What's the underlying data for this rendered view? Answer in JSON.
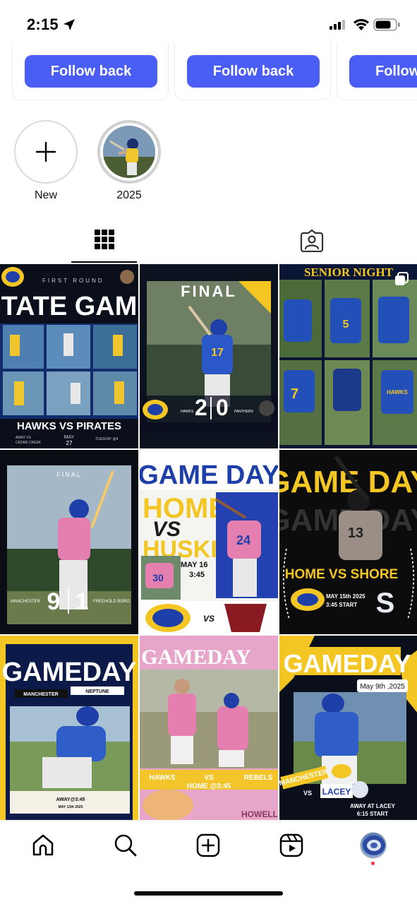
{
  "status_bar": {
    "time": "2:15"
  },
  "suggestions": [
    {
      "button_label": "Follow back"
    },
    {
      "button_label": "Follow back"
    },
    {
      "button_label": "Follow back"
    }
  ],
  "highlights": [
    {
      "label": "New",
      "icon": "plus-icon"
    },
    {
      "label": "2025",
      "icon": "photo"
    }
  ],
  "tabs": [
    {
      "name": "posts-grid",
      "icon": "grid-icon",
      "active": true
    },
    {
      "name": "tagged",
      "icon": "tagged-person-icon",
      "active": false
    }
  ],
  "posts": [
    {
      "title": "STATE GAME",
      "top": "FIRST ROUND",
      "bottom": "HAWKS VS PIRATES",
      "sub_left": "AWAY VS",
      "sub_left2": "CEDAR CREEK",
      "month": "MAY",
      "day": "27",
      "sub_right": "TUESDAY @4",
      "pinned": false
    },
    {
      "title": "FINAL",
      "left_team": "HAWKS",
      "right_team": "PANTHERS",
      "score_left": "2",
      "score_right": "0",
      "jersey": "17",
      "pinned": false
    },
    {
      "title": "SENIOR NIGHT",
      "jerseys": [
        "5",
        "7"
      ],
      "text_jersey": "HAWKS",
      "pinned": true
    },
    {
      "title": "FINAL",
      "left_team": "MANCHESTER",
      "right_team": "FREEHOLD BORO",
      "score_left": "9",
      "score_right": "1",
      "pinned": false
    },
    {
      "title": "GAME DAY",
      "line1": "HOME",
      "vs": "VS",
      "line2": "HUSKIES",
      "date": "MAY 16",
      "time": "3:45",
      "jersey_a": "30",
      "jersey_b": "24",
      "pinned": false
    },
    {
      "title": "GAME DAY",
      "line": "HOME VS SHORE",
      "date": "MAY 15th 2025",
      "start": "3:45 START",
      "jersey": "13",
      "pinned": false
    },
    {
      "title": "GAMEDAY",
      "left_team": "MANCHESTER",
      "right_team": "NEPTUNE",
      "away": "AWAY@3:45",
      "date": "MAY 13th 2025",
      "pinned": false
    },
    {
      "title": "GAMEDAY",
      "left_team": "HAWKS",
      "vs": "VS",
      "right_team": "REBELS",
      "home": "HOME @3:45",
      "footer": "HOWELL",
      "pinned": false
    },
    {
      "title": "GAMEDAY",
      "date": "May 9th ,2025",
      "left_team": "MANCHESTER",
      "vs": "VS",
      "right_team": "LACEY",
      "away": "AWAY AT LACEY",
      "start": "6:15 START",
      "pinned": false
    }
  ],
  "nav": [
    {
      "name": "home",
      "icon": "home-icon"
    },
    {
      "name": "search",
      "icon": "search-icon"
    },
    {
      "name": "create",
      "icon": "create-plus-icon"
    },
    {
      "name": "reels",
      "icon": "reels-icon"
    },
    {
      "name": "profile",
      "icon": "profile-avatar"
    }
  ],
  "colors": {
    "accent": "#4a5df5",
    "hawks_blue": "#1f3fa8",
    "hawks_gold": "#f3c623",
    "pink": "#e47fb0",
    "notification": "#ff3040"
  }
}
